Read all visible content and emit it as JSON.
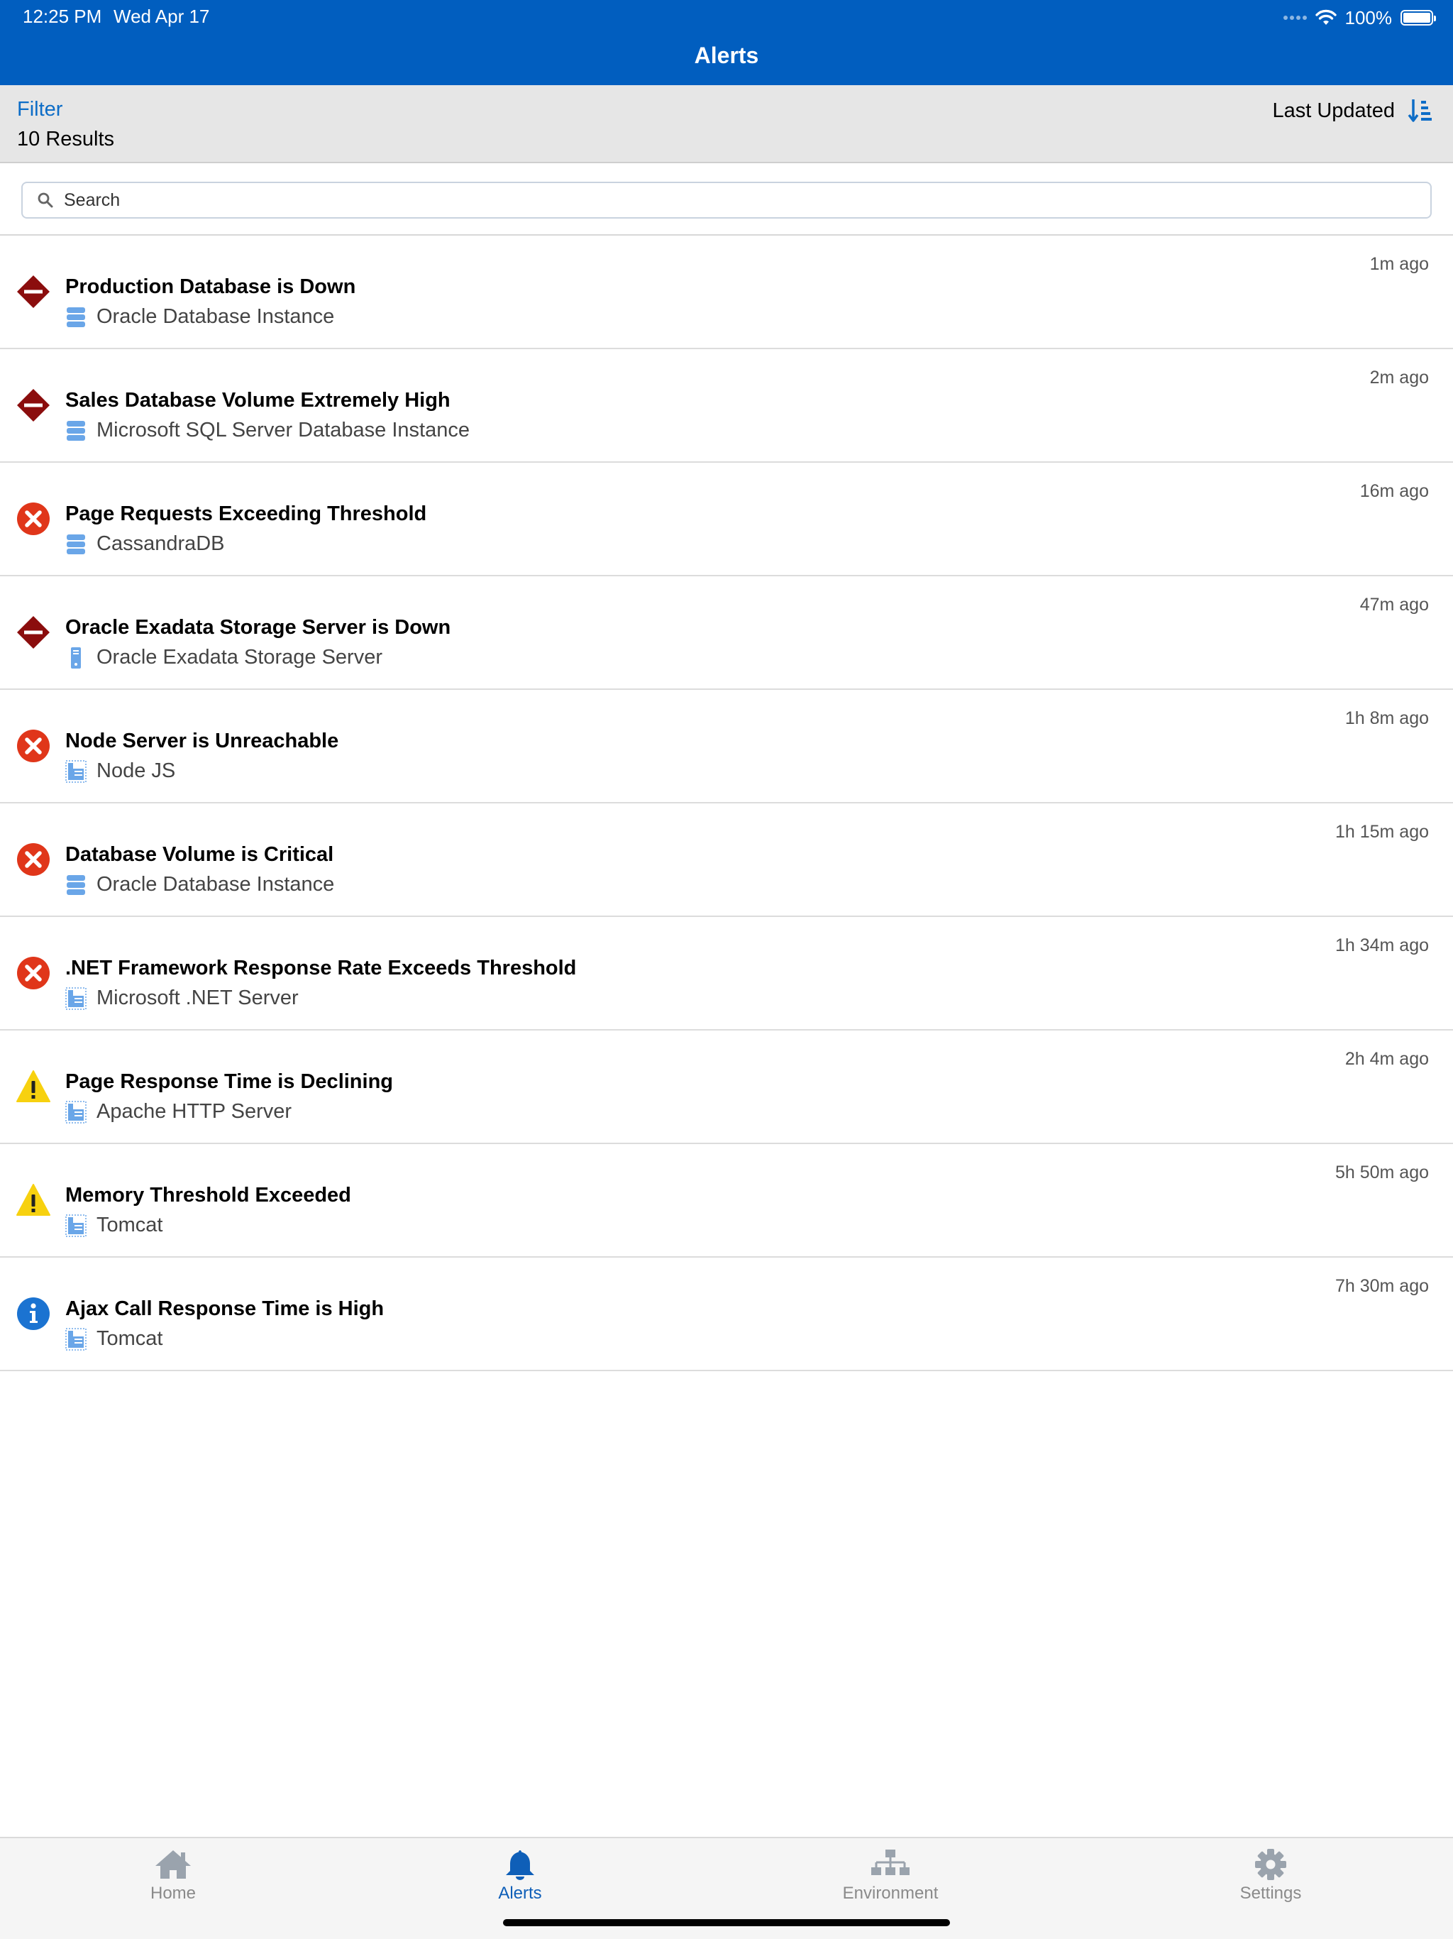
{
  "status_bar": {
    "time": "12:25 PM",
    "date": "Wed Apr 17",
    "battery": "100%"
  },
  "header": {
    "title": "Alerts"
  },
  "filter_bar": {
    "filter_label": "Filter",
    "results": "10 Results",
    "sort_label": "Last Updated"
  },
  "search": {
    "placeholder": "Search"
  },
  "colors": {
    "header_blue": "#015ebf",
    "fatal_maroon": "#8b0d0d",
    "critical_red": "#e0361a",
    "warning_yellow": "#f7d10f",
    "info_blue": "#1b73d1",
    "source_icon_blue": "#6aa6e8"
  },
  "alerts": [
    {
      "severity": "fatal",
      "severity_icon": "fatal-diamond-icon",
      "title": "Production Database is Down",
      "source_icon": "database-icon",
      "source": "Oracle Database Instance",
      "time": "1m ago"
    },
    {
      "severity": "fatal",
      "severity_icon": "fatal-diamond-icon",
      "title": "Sales Database Volume Extremely High",
      "source_icon": "database-icon",
      "source": "Microsoft SQL Server Database Instance",
      "time": "2m ago"
    },
    {
      "severity": "critical",
      "severity_icon": "critical-x-icon",
      "title": "Page Requests Exceeding Threshold",
      "source_icon": "database-icon",
      "source": "CassandraDB",
      "time": "16m ago"
    },
    {
      "severity": "fatal",
      "severity_icon": "fatal-diamond-icon",
      "title": "Oracle Exadata Storage Server is Down",
      "source_icon": "storage-server-icon",
      "source": "Oracle Exadata Storage Server",
      "time": "47m ago"
    },
    {
      "severity": "critical",
      "severity_icon": "critical-x-icon",
      "title": "Node Server is Unreachable",
      "source_icon": "app-server-icon",
      "source": "Node JS",
      "time": "1h 8m ago"
    },
    {
      "severity": "critical",
      "severity_icon": "critical-x-icon",
      "title": "Database Volume is Critical",
      "source_icon": "database-icon",
      "source": "Oracle Database Instance",
      "time": "1h 15m ago"
    },
    {
      "severity": "critical",
      "severity_icon": "critical-x-icon",
      "title": ".NET Framework Response Rate Exceeds Threshold",
      "source_icon": "app-server-icon",
      "source": "Microsoft .NET Server",
      "time": "1h 34m ago"
    },
    {
      "severity": "warning",
      "severity_icon": "warning-triangle-icon",
      "title": "Page Response Time is Declining",
      "source_icon": "app-server-icon",
      "source": "Apache HTTP Server",
      "time": "2h 4m ago"
    },
    {
      "severity": "warning",
      "severity_icon": "warning-triangle-icon",
      "title": "Memory Threshold Exceeded",
      "source_icon": "app-server-icon",
      "source": "Tomcat",
      "time": "5h 50m ago"
    },
    {
      "severity": "info",
      "severity_icon": "info-circle-icon",
      "title": "Ajax Call Response Time is High",
      "source_icon": "app-server-icon",
      "source": "Tomcat",
      "time": "7h 30m ago"
    }
  ],
  "tabs": [
    {
      "label": "Home",
      "icon": "home-icon",
      "active": false
    },
    {
      "label": "Alerts",
      "icon": "bell-icon",
      "active": true
    },
    {
      "label": "Environment",
      "icon": "hierarchy-icon",
      "active": false
    },
    {
      "label": "Settings",
      "icon": "gear-icon",
      "active": false
    }
  ]
}
